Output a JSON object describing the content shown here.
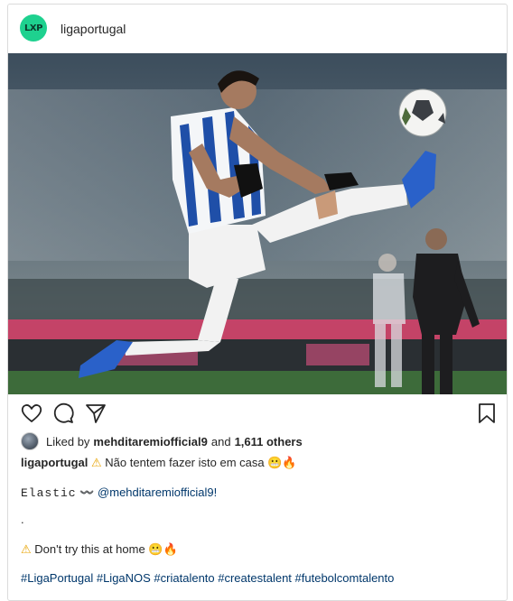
{
  "post": {
    "username": "ligaportugal",
    "avatar_text": "LXP",
    "liked_by_prefix": "Liked by",
    "liked_by_user": "mehditaremiofficial9",
    "liked_by_suffix": "and",
    "liked_others": "1,611 others",
    "caption_line1_user": "ligaportugal",
    "caption_line1_text": "Não tentem fazer isto em casa",
    "caption_line2_text": "Elastic",
    "caption_line2_dash": "〰️",
    "caption_line2_mention": "@mehditaremiofficial9!",
    "caption_dot": ".",
    "caption_line4_text": "Don't try this at home",
    "hashtags": "#LigaPortugal #LigaNOS #criatalento #createstalent #futebolcomtalento"
  },
  "icons": {
    "like": "heart-icon",
    "comment": "comment-icon",
    "share": "paper-plane-icon",
    "save": "bookmark-icon",
    "warning": "warning-icon",
    "grin": "grimacing-emoji",
    "fire": "fire-emoji"
  },
  "colors": {
    "avatar_bg": "#1ed18f",
    "link": "#00376b",
    "border": "#dbdbdb"
  }
}
